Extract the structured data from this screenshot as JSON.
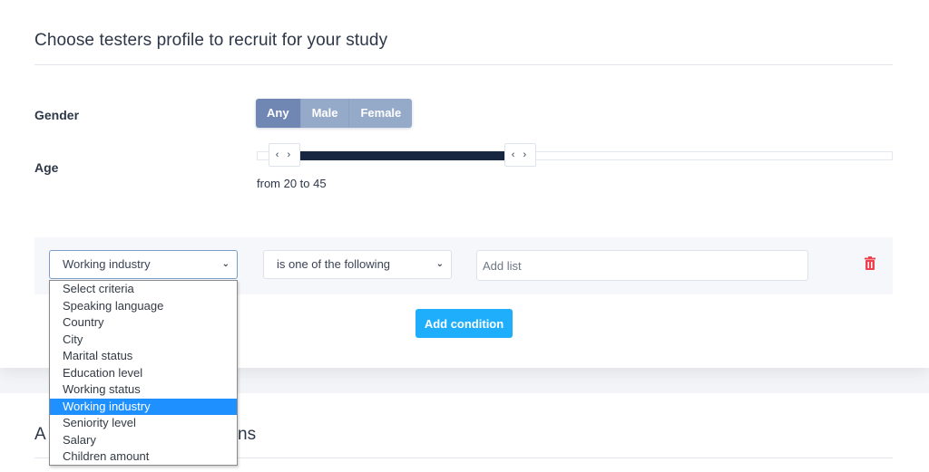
{
  "profile_section": {
    "title": "Choose testers profile to recruit for your study",
    "gender": {
      "label": "Gender",
      "options": [
        "Any",
        "Male",
        "Female"
      ],
      "selected": "Any"
    },
    "age": {
      "label": "Age",
      "min_value": 20,
      "max_value": 45,
      "range_text": "from 20 to 45",
      "handle_glyph": "‹ ›"
    },
    "condition": {
      "criteria_value": "Working industry",
      "operator_value": "is one of the following",
      "list_placeholder": "Add list",
      "delete_icon": "trash-icon",
      "criteria_options": [
        "Select criteria",
        "Speaking language",
        "Country",
        "City",
        "Marital status",
        "Education level",
        "Working status",
        "Working industry",
        "Seniority level",
        "Salary",
        "Children amount"
      ],
      "highlighted_option": "Working industry"
    },
    "add_condition_label": "Add condition"
  },
  "next_section": {
    "title_visible_start": "A",
    "title_visible_end": "ns"
  },
  "colors": {
    "accent": "#1eaefc",
    "gender_active": "#6f87b2",
    "gender_inactive": "#95a9c9",
    "slider_fill": "#172641",
    "danger": "#f0424e",
    "dropdown_highlight": "#1e90ff"
  },
  "icons": {
    "chevron": "chevron-down-icon",
    "delete": "trash-icon"
  }
}
